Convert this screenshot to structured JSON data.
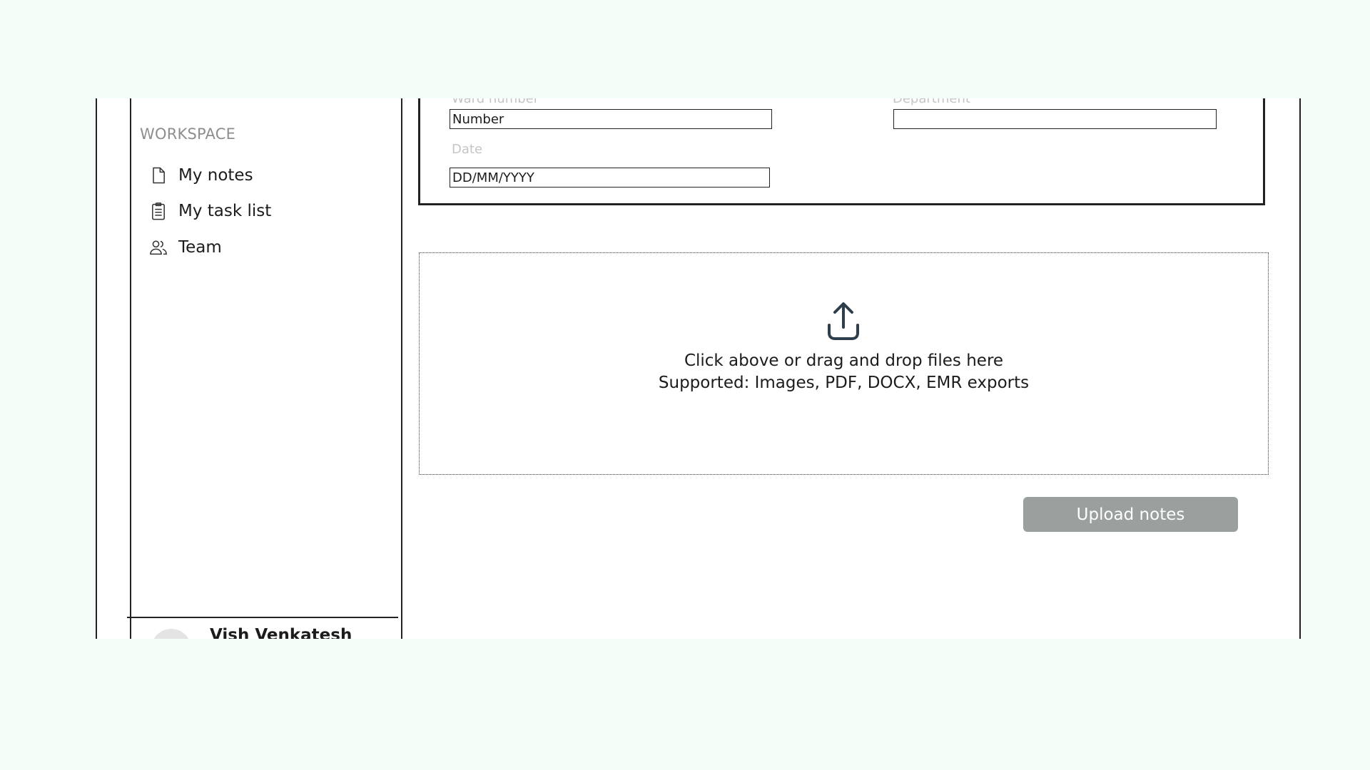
{
  "sidebar": {
    "section_label": "WORKSPACE",
    "items": [
      {
        "label": "My notes",
        "icon": "document-icon"
      },
      {
        "label": "My task list",
        "icon": "clipboard-icon"
      },
      {
        "label": "Team",
        "icon": "users-icon"
      }
    ],
    "user": {
      "name": "Vish Venkatesh"
    }
  },
  "form": {
    "ward_label": "Ward number",
    "ward_placeholder": "Number",
    "department_label": "Department",
    "department_placeholder": "",
    "date_label": "Date",
    "date_placeholder": "DD/MM/YYYY"
  },
  "dropzone": {
    "icon": "upload-icon",
    "main_text": "Click above or drag and drop files here",
    "sub_text": "Supported: Images, PDF, DOCX, EMR exports"
  },
  "actions": {
    "upload_label": "Upload notes"
  },
  "colors": {
    "background": "#f3fcf7",
    "button_disabled": "#9aa09d",
    "icon_dark": "#2e3e4a"
  }
}
